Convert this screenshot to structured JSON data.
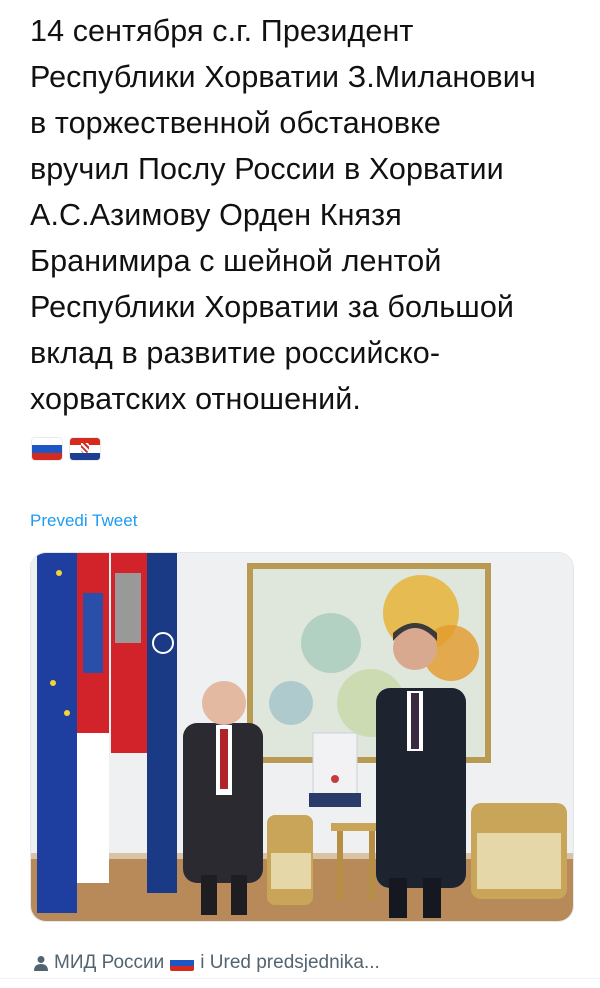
{
  "tweet": {
    "text": "14 сентября с.г. Президент\nРеспублики Хорватии З.Миланович\nв торжественной обстановке\nвручил Послу России в Хорватии\nА.С.Азимову Орден Князя\nБранимира с шейной лентой\nРеспублики Хорватии за большой\nвклад в развитие российско-\nхорватских отношений.",
    "flags": [
      {
        "icon": "russia-flag-icon",
        "colors": [
          "#ffffff",
          "#1c57c4",
          "#d52b1e"
        ]
      },
      {
        "icon": "croatia-flag-icon",
        "colors": [
          "#d52b1e",
          "#ffffff",
          "#1c3f94"
        ]
      }
    ],
    "translate_label": "Prevedi Tweet"
  },
  "media": {
    "description_icon": "photo-image"
  },
  "footer": {
    "person_icon": "person-icon",
    "account_1": "МИД России",
    "flag_icon": "russia-flag-icon",
    "account_2": "i Ured predsjednika..."
  },
  "colors": {
    "link": "#1d9bf0",
    "text": "#111111",
    "muted": "#536471"
  }
}
